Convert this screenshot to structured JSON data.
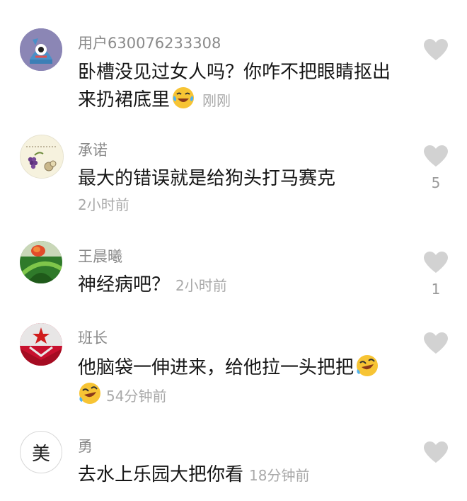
{
  "comments": [
    {
      "username": "用户630076233308",
      "line1": "卧槽没见过女人吗？你咋不把眼睛抠出",
      "line2": "来扔裙底里",
      "time": "刚刚",
      "avatar": "blue-monster-avatar",
      "likes": ""
    },
    {
      "username": "承诺",
      "line1": "最大的错误就是给狗头打马赛克",
      "time": "2小时前",
      "avatar": "grape-sketch-avatar",
      "likes": "5"
    },
    {
      "username": "王晨曦",
      "line1": "神经病吧？",
      "time": "2小时前",
      "avatar": "rose-avatar",
      "likes": "1"
    },
    {
      "username": "班长",
      "line1": "他脑袋一伸进来，给他拉一头把把",
      "time": "54分钟前",
      "avatar": "red-star-avatar",
      "likes": ""
    },
    {
      "username": "勇",
      "line1": "去水上乐园大把你看",
      "time": "18分钟前",
      "avatar_text": "美",
      "likes": ""
    }
  ],
  "colors": {
    "username": "#8a8a8a",
    "text": "#161616",
    "time": "#a9a9a9",
    "heart": "#d2d2d2"
  }
}
